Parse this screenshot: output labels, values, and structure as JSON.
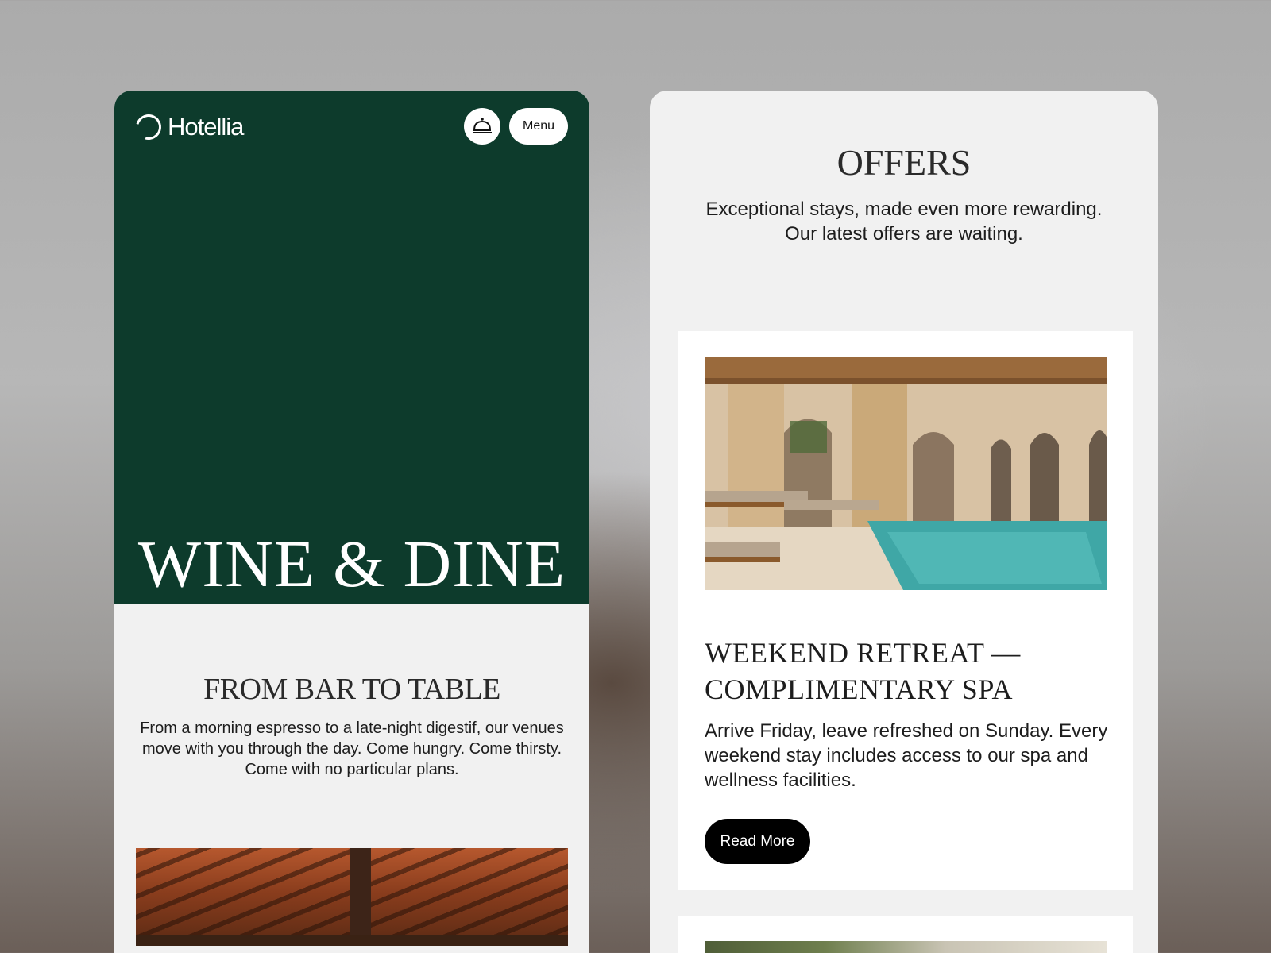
{
  "left_screen": {
    "brand": "Hotellia",
    "menu_label": "Menu",
    "hero_title": "WINE & DINE",
    "section_title": "FROM BAR TO TABLE",
    "section_text": "From a morning espresso to a late-night digestif, our venues move with you through the day. Come hungry. Come thirsty. Come with no particular plans.",
    "colors": {
      "hero_bg": "#0d3b2c",
      "page_bg": "#f1f1f1"
    },
    "icons": {
      "logo": "ring-logo-icon",
      "bell": "concierge-bell-icon"
    }
  },
  "right_screen": {
    "title": "OFFERS",
    "subtitle": "Exceptional stays, made even more rewarding. Our latest offers are waiting.",
    "offer": {
      "title": "WEEKEND RETREAT — COMPLIMENTARY SPA",
      "text": "Arrive Friday, leave refreshed on Sunday. Every weekend stay includes access to our spa and wellness facilities.",
      "button_label": "Read More"
    }
  }
}
